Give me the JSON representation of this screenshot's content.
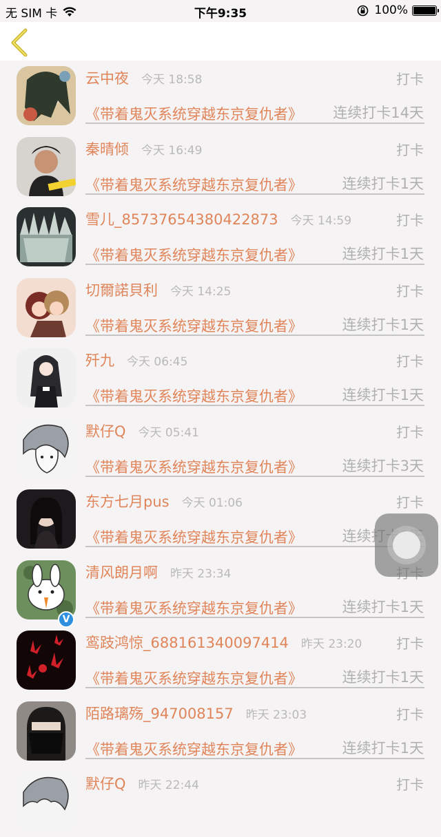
{
  "status_bar": {
    "carrier": "无 SIM 卡",
    "time": "下午9:35",
    "battery": "100%"
  },
  "colors": {
    "accent": "#e0855a",
    "muted": "#b0b0b0",
    "background": "#f6f3f4"
  },
  "nav": {
    "back_icon": "chevron-left-icon"
  },
  "records": [
    {
      "name": "云中夜",
      "time": "今天 18:58",
      "action": "打卡",
      "book": "《带着鬼灭系统穿越东京复仇者》",
      "streak": "连续打卡14天"
    },
    {
      "name": "秦晴倾",
      "time": "今天 16:49",
      "action": "打卡",
      "book": "《带着鬼灭系统穿越东京复仇者》",
      "streak": "连续打卡1天"
    },
    {
      "name": "雪儿_8573765438042287​3",
      "time": "今天 14:59",
      "action": "打卡",
      "book": "《带着鬼灭系统穿越东京复仇者》",
      "streak": "连续打卡1天"
    },
    {
      "name": "切爾諾貝利",
      "time": "今天 14:25",
      "action": "打卡",
      "book": "《带着鬼灭系统穿越东京复仇者》",
      "streak": "连续打卡1天"
    },
    {
      "name": "歼九",
      "time": "今天 06:45",
      "action": "打卡",
      "book": "《带着鬼灭系统穿越东京复仇者》",
      "streak": "连续打卡1天"
    },
    {
      "name": "默仔Q",
      "time": "今天 05:41",
      "action": "打卡",
      "book": "《带着鬼灭系统穿越东京复仇者》",
      "streak": "连续打卡3天"
    },
    {
      "name": "东方七月pus",
      "time": "今天 01:06",
      "action": "打卡",
      "book": "《带着鬼灭系统穿越东京复仇者》",
      "streak": "连续打卡1天"
    },
    {
      "name": "清风朗月啊",
      "time": "昨天 23:34",
      "action": "打卡",
      "book": "《带着鬼灭系统穿越东京复仇者》",
      "streak": "连续打卡1天"
    },
    {
      "name": "鸾跂鸿惊_688161340097414",
      "time": "昨天 23:20",
      "action": "打卡",
      "book": "《带着鬼灭系统穿越东京复仇者》",
      "streak": "连续打卡1天"
    },
    {
      "name": "陌路璃殇_947008157",
      "time": "昨天 23:03",
      "action": "打卡",
      "book": "《带着鬼灭系统穿越东京复仇者》",
      "streak": "连续打卡1天"
    },
    {
      "name": "默仔Q",
      "time": "昨天 22:44",
      "action": "打卡",
      "book": "",
      "streak": ""
    }
  ]
}
